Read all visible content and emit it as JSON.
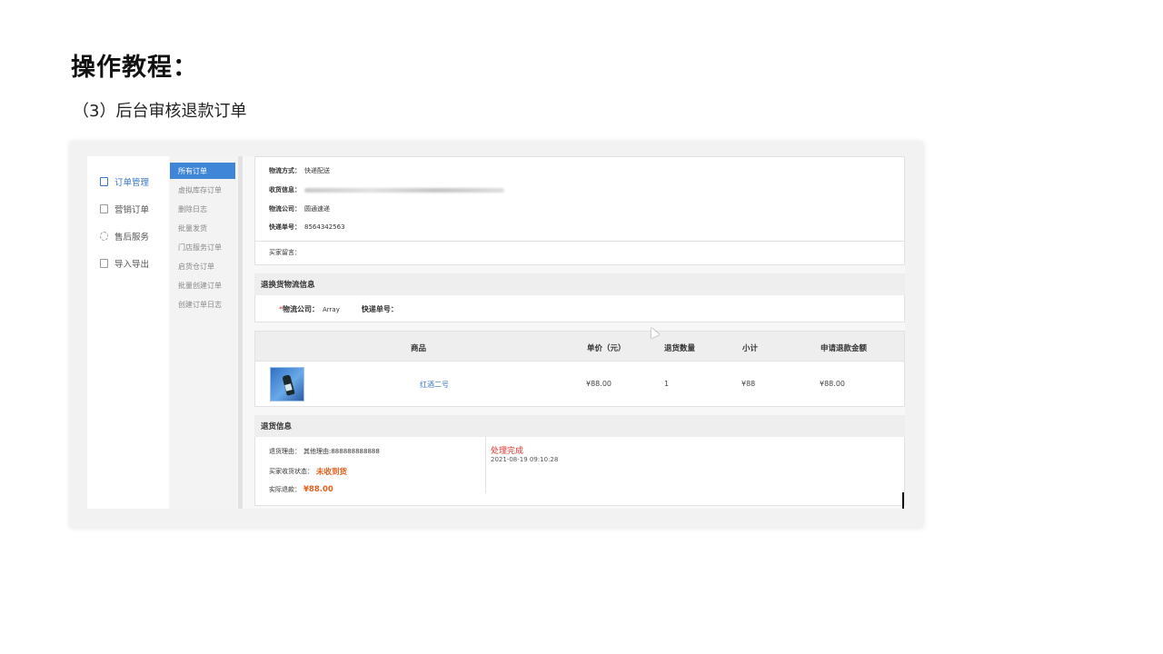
{
  "page": {
    "heading": "操作教程：",
    "subheading": "（3）后台审核退款订单"
  },
  "sidebar": {
    "items": [
      {
        "label": "订单管理",
        "icon": "document-icon",
        "active": true
      },
      {
        "label": "营销订单",
        "icon": "document-icon",
        "active": false
      },
      {
        "label": "售后服务",
        "icon": "headset-icon",
        "active": false
      },
      {
        "label": "导入导出",
        "icon": "spreadsheet-icon",
        "active": false
      }
    ]
  },
  "subnav": {
    "items": [
      {
        "label": "所有订单",
        "active": true
      },
      {
        "label": "虚拟库存订单",
        "active": false
      },
      {
        "label": "删除日志",
        "active": false
      },
      {
        "label": "批量发货",
        "active": false
      },
      {
        "label": "门店服务订单",
        "active": false
      },
      {
        "label": "启货仓订单",
        "active": false
      },
      {
        "label": "批量创建订单",
        "active": false
      },
      {
        "label": "创建订单日志",
        "active": false
      }
    ]
  },
  "logistics": {
    "method_label": "物流方式：",
    "method_value": "快递配送",
    "receiver_label": "收货信息：",
    "company_label": "物流公司：",
    "company_value": "圆通速递",
    "tracking_label": "快递单号：",
    "tracking_value": "8564342563",
    "buyer_note_label": "买家留言："
  },
  "return_logistics": {
    "title": "退换货物流信息",
    "required_mark": "*",
    "company_label": "物流公司：",
    "company_value": "Array",
    "tracking_label": "快递单号："
  },
  "product_table": {
    "headers": [
      "商品",
      "单价（元）",
      "退货数量",
      "小计",
      "申请退款金额"
    ],
    "rows": [
      {
        "name": "红酒二号",
        "price": "¥88.00",
        "qty": "1",
        "subtotal": "¥88",
        "refund": "¥88.00"
      }
    ]
  },
  "return_info": {
    "title": "退货信息",
    "reason_label": "退货理由：",
    "reason_value": "其他理由:888888888888",
    "receipt_label": "买家收货状态：",
    "receipt_value": "未收到货",
    "refund_label": "实际退款：",
    "refund_value": "¥88.00",
    "status": "处理完成",
    "timestamp": "2021-08-19 09:10:28"
  },
  "colors": {
    "accent": "#3f86d9",
    "link": "#3a77c9",
    "warning": "#e8601c",
    "status": "#d9342b"
  }
}
